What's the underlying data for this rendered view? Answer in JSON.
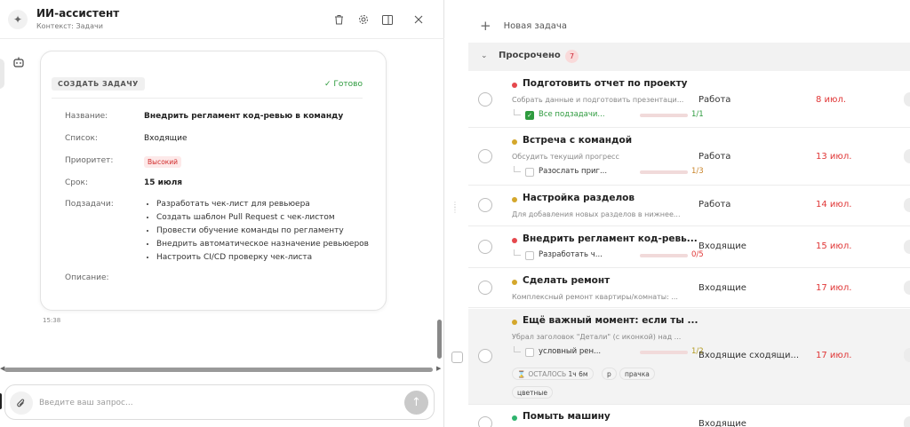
{
  "assistant": {
    "title": "ИИ-ассистент",
    "context": "Контекст: Задачи",
    "card": {
      "action_label": "СОЗДАТЬ ЗАДАЧУ",
      "status": "✓ Готово",
      "fields": {
        "name_label": "Название:",
        "name_value": "Внедрить регламент код-ревью в команду",
        "list_label": "Список:",
        "list_value": "Входящие",
        "priority_label": "Приоритет:",
        "priority_value": "Высокий",
        "due_label": "Срок:",
        "due_value": "15 июля",
        "subtasks_label": "Подзадачи:",
        "description_label": "Описание:"
      },
      "subtasks": [
        "Разработать чек-лист для ревьюера",
        "Создать шаблон Pull Request с чек-листом",
        "Провести обучение команды по регламенту",
        "Внедрить автоматическое назначение ревьюеров",
        "Настроить CI/CD проверку чек-листа"
      ]
    },
    "message_time": "15:38",
    "input": {
      "placeholder": "Введите ваш запрос...",
      "value": ""
    }
  },
  "tasks_panel": {
    "new_task_label": "Новая задача",
    "group": {
      "title": "Просрочено",
      "count": "7"
    },
    "colors": {
      "red": "#e5484d",
      "yellow": "#d4a72c",
      "green": "#2fb46e",
      "overdue": "#e03636"
    },
    "tasks": [
      {
        "title": "Подготовить отчет по проекту",
        "desc": "Собрать данные и подготовить презентаци...",
        "sub_title": "Все подзадачи...",
        "sub_count": "1/1",
        "sub_progress": 1.0,
        "sub_done": true,
        "list": "Работа",
        "due": "8 июл.",
        "dot": "#e5484d",
        "bar": "#2fb43a"
      },
      {
        "title": "Встреча с командой",
        "desc": "Обсудить текущий прогресс",
        "sub_title": "Разослать приг...",
        "sub_count": "1/3",
        "sub_progress": 0.33,
        "sub_done": false,
        "list": "Работа",
        "due": "13 июл.",
        "dot": "#d4a72c",
        "bar": "#c9842a"
      },
      {
        "title": "Настройка разделов",
        "desc": "Для добавления новых разделов в нижнее...",
        "list": "Работа",
        "due": "14 июл.",
        "dot": "#d4a72c"
      },
      {
        "title": "Внедрить регламент код-ревь...",
        "sub_title": "Разработать ч...",
        "sub_count": "0/5",
        "sub_progress": 0.0,
        "sub_done": false,
        "list": "Входящие",
        "due": "15 июл.",
        "dot": "#e5484d",
        "bar": "#e5484d"
      },
      {
        "title": "Сделать ремонт",
        "desc": "Комплексный ремонт квартиры/комнаты: ...",
        "list": "Входящие",
        "due": "17 июл.",
        "dot": "#d4a72c"
      },
      {
        "title": "Ещё важный момент: если ты ...",
        "desc": "Убрал заголовок \"Детали\" (с иконкой) над ...",
        "sub_title": "условный рен...",
        "sub_count": "1/2",
        "sub_progress": 0.5,
        "sub_done": false,
        "list": "Входящие сходящи...",
        "due": "17 июл.",
        "dot": "#d4a72c",
        "bar": "#c9b12a",
        "tags": {
          "remaining_label": "ОСТАЛОСЬ",
          "remaining_value": "1ч 6м",
          "t1": "р",
          "t2": "прачка",
          "t3": "цветные"
        }
      },
      {
        "title": "Помыть машину",
        "list": "Входящие",
        "dot": "#2fb46e"
      }
    ]
  }
}
